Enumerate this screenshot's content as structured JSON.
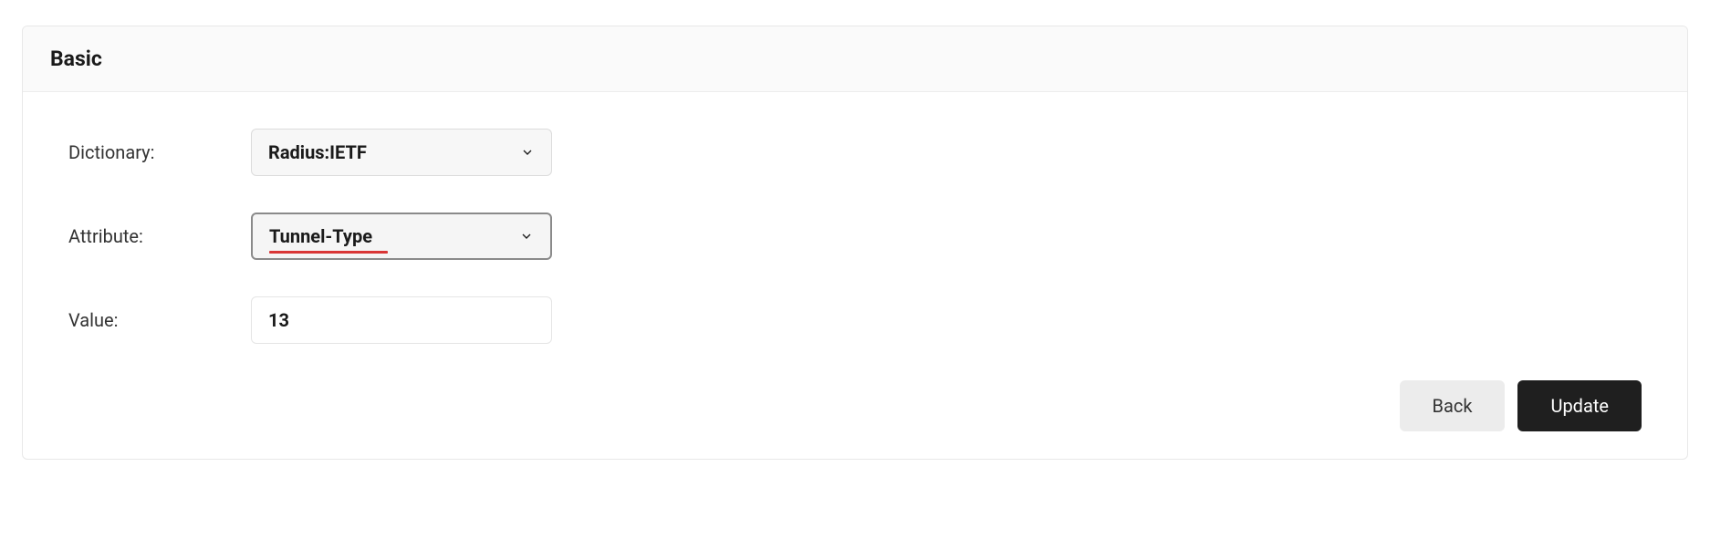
{
  "panel": {
    "title": "Basic"
  },
  "form": {
    "dictionary": {
      "label": "Dictionary:",
      "value": "Radius:IETF"
    },
    "attribute": {
      "label": "Attribute:",
      "value": "Tunnel-Type"
    },
    "value": {
      "label": "Value:",
      "value": "13"
    }
  },
  "buttons": {
    "back": "Back",
    "update": "Update"
  }
}
